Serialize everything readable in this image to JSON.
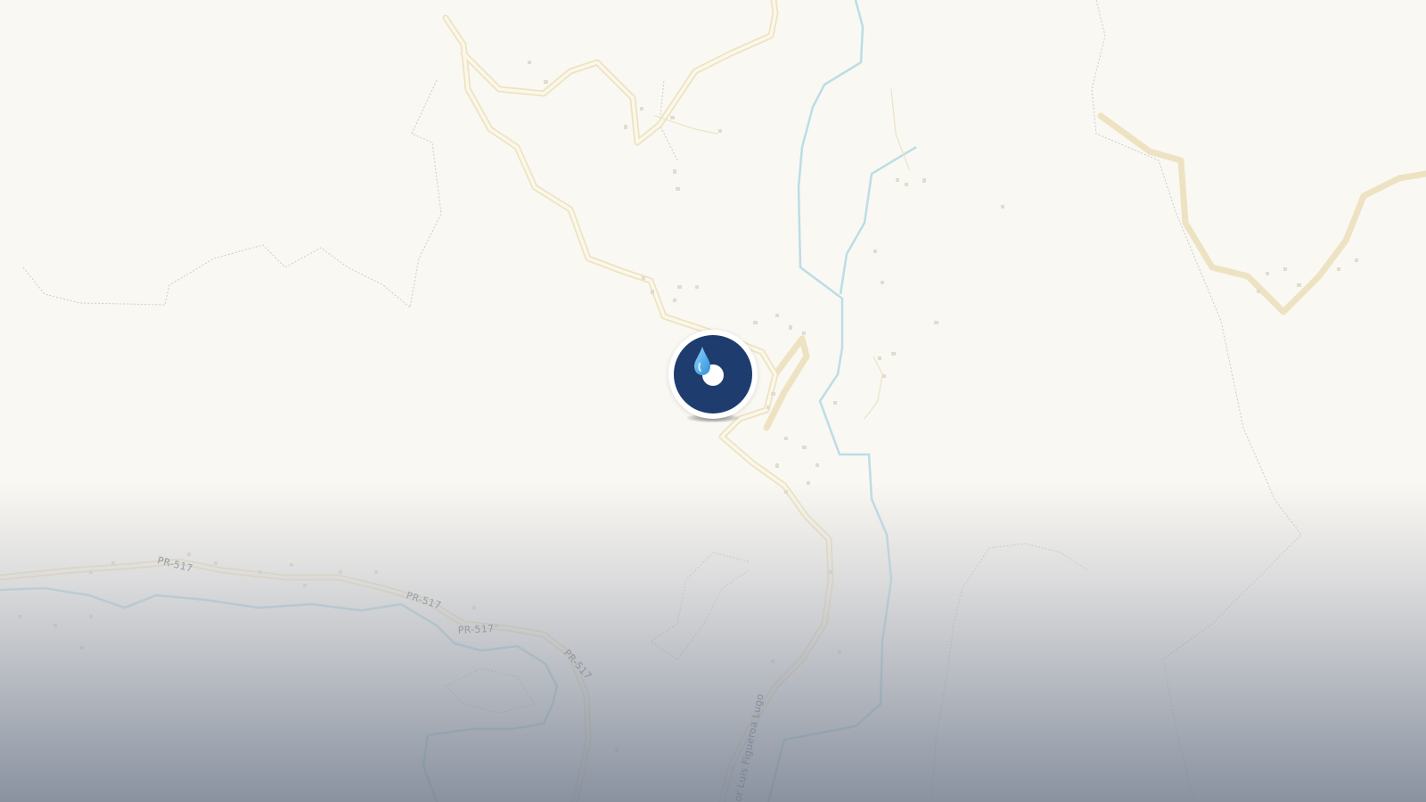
{
  "map": {
    "road_labels": [
      "PR-517",
      "PR-517",
      "PR-517",
      "PR-517",
      "or Luis Figueroa Lugo"
    ]
  },
  "marker": {
    "icon": "water-drop-icon",
    "colors": {
      "core": "#1f3c6e",
      "ring": "#ffffff",
      "drop": "#4fb3ee"
    }
  },
  "colors": {
    "land": "#faf8f2",
    "road": "#f4ecd3",
    "water": "#bcdde6",
    "contour": "#c9ccd0",
    "fade_bottom": "#76809a"
  }
}
